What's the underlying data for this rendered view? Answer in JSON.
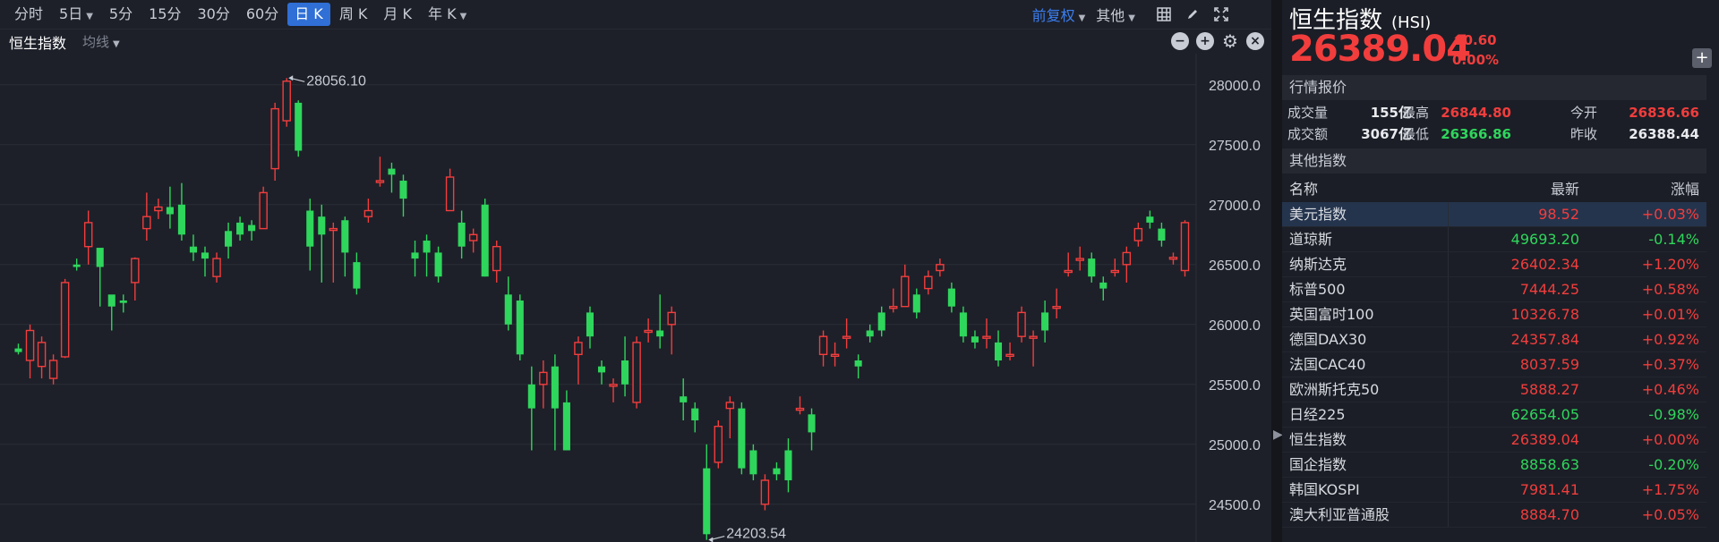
{
  "toolbar": {
    "tabs": [
      {
        "label": "分时",
        "caret": false
      },
      {
        "label": "5日",
        "caret": true
      },
      {
        "label": "5分",
        "caret": false
      },
      {
        "label": "15分",
        "caret": false
      },
      {
        "label": "30分",
        "caret": false
      },
      {
        "label": "60分",
        "caret": false
      },
      {
        "label": "日 K",
        "caret": false,
        "active": true
      },
      {
        "label": "周 K",
        "caret": false
      },
      {
        "label": "月 K",
        "caret": false
      },
      {
        "label": "年 K",
        "caret": true
      }
    ],
    "adjust_label": "前复权",
    "other_label": "其他",
    "icons": [
      "grid-icon",
      "pen-icon",
      "fullscreen-icon"
    ]
  },
  "subbar": {
    "title": "恒生指数",
    "ma_label": "均线",
    "controls": [
      "minus-icon",
      "plus-icon",
      "gear-icon",
      "close-icon"
    ]
  },
  "quote": {
    "name": "恒生指数",
    "code": "(HSI)",
    "price": "26389.04",
    "change": "0.60",
    "change_pct": "0.00%",
    "direction": "up"
  },
  "market": {
    "section_title": "行情报价",
    "rows": [
      {
        "l1": "成交量",
        "v1": "155亿",
        "l2": "最高",
        "v2": "26844.80",
        "l3": "今开",
        "v3": "26836.66",
        "c2": "red",
        "c3": "red"
      },
      {
        "l1": "成交额",
        "v1": "3067亿",
        "l2": "最低",
        "v2": "26366.86",
        "l3": "昨收",
        "v3": "26388.44",
        "c2": "green",
        "c3": "white"
      }
    ]
  },
  "other_indices": {
    "section_title": "其他指数",
    "columns": [
      "名称",
      "最新",
      "涨幅"
    ],
    "rows": [
      {
        "name": "美元指数",
        "last": "98.52",
        "chg": "+0.03%",
        "color": "red",
        "selected": true
      },
      {
        "name": "道琼斯",
        "last": "49693.20",
        "chg": "-0.14%",
        "color": "green"
      },
      {
        "name": "纳斯达克",
        "last": "26402.34",
        "chg": "+1.20%",
        "color": "red"
      },
      {
        "name": "标普500",
        "last": "7444.25",
        "chg": "+0.58%",
        "color": "red"
      },
      {
        "name": "英国富时100",
        "last": "10326.78",
        "chg": "+0.01%",
        "color": "red"
      },
      {
        "name": "德国DAX30",
        "last": "24357.84",
        "chg": "+0.92%",
        "color": "red"
      },
      {
        "name": "法国CAC40",
        "last": "8037.59",
        "chg": "+0.37%",
        "color": "red"
      },
      {
        "name": "欧洲斯托克50",
        "last": "5888.27",
        "chg": "+0.46%",
        "color": "red"
      },
      {
        "name": "日经225",
        "last": "62654.05",
        "chg": "-0.98%",
        "color": "green"
      },
      {
        "name": "恒生指数",
        "last": "26389.04",
        "chg": "+0.00%",
        "color": "red"
      },
      {
        "name": "国企指数",
        "last": "8858.63",
        "chg": "-0.20%",
        "color": "green"
      },
      {
        "name": "韩国KOSPI",
        "last": "7981.41",
        "chg": "+1.75%",
        "color": "red"
      },
      {
        "name": "澳大利亚普通股",
        "last": "8884.70",
        "chg": "+0.05%",
        "color": "red"
      }
    ]
  },
  "colors": {
    "up": "#f23d3d",
    "down": "#2fd65c",
    "accent": "#2f6fd6",
    "grid": "#2a2d36"
  },
  "chart_data": {
    "type": "candlestick",
    "ylim": [
      24200,
      28200
    ],
    "ticks": [
      "28000.0",
      "27500.0",
      "27000.0",
      "26500.0",
      "26000.0",
      "25500.0",
      "25000.0",
      "24500.0"
    ],
    "annotations": [
      {
        "label": "28056.10",
        "value": 28056.1
      },
      {
        "label": "24203.54",
        "value": 24203.54
      }
    ],
    "candles": [
      [
        25800,
        25770,
        25840,
        25750
      ],
      [
        25700,
        25950,
        26000,
        25550
      ],
      [
        25650,
        25850,
        25900,
        25550
      ],
      [
        25550,
        25700,
        25750,
        25500
      ],
      [
        25730,
        26350,
        26380,
        25720
      ],
      [
        26500,
        26480,
        26550,
        26450
      ],
      [
        26650,
        26850,
        26950,
        26500
      ],
      [
        26640,
        26480,
        26500,
        26150
      ],
      [
        26250,
        26150,
        26200,
        25950
      ],
      [
        26200,
        26180,
        26250,
        26100
      ],
      [
        26350,
        26550,
        26560,
        26200
      ],
      [
        26800,
        26900,
        27100,
        26700
      ],
      [
        26950,
        26980,
        27050,
        26880
      ],
      [
        26980,
        26920,
        27150,
        26800
      ],
      [
        27000,
        26750,
        27180,
        26700
      ],
      [
        26650,
        26600,
        26750,
        26530
      ],
      [
        26600,
        26550,
        26650,
        26400
      ],
      [
        26400,
        26550,
        26600,
        26350
      ],
      [
        26780,
        26650,
        26850,
        26550
      ],
      [
        26850,
        26750,
        26900,
        26700
      ],
      [
        26830,
        26780,
        26870,
        26700
      ],
      [
        26800,
        27100,
        27150,
        26800
      ],
      [
        27300,
        27800,
        27850,
        27200
      ],
      [
        27700,
        28030,
        28056,
        27650
      ],
      [
        27850,
        27450,
        27870,
        27400
      ],
      [
        26950,
        26650,
        27050,
        26450
      ],
      [
        26900,
        26750,
        27000,
        26350
      ],
      [
        26800,
        26800,
        26850,
        26350
      ],
      [
        26870,
        26600,
        26900,
        26400
      ],
      [
        26520,
        26300,
        26600,
        26250
      ],
      [
        26900,
        26950,
        27050,
        26850
      ],
      [
        27200,
        27200,
        27400,
        27150
      ],
      [
        27300,
        27250,
        27350,
        27100
      ],
      [
        27200,
        27050,
        27250,
        26900
      ],
      [
        26600,
        26550,
        26700,
        26400
      ],
      [
        26700,
        26600,
        26750,
        26400
      ],
      [
        26600,
        26400,
        26650,
        26350
      ],
      [
        26950,
        27230,
        27300,
        26950
      ],
      [
        26850,
        26650,
        26950,
        26550
      ],
      [
        26700,
        26750,
        26800,
        26600
      ],
      [
        27000,
        26400,
        27050,
        26400
      ],
      [
        26450,
        26650,
        26700,
        26350
      ],
      [
        26250,
        26000,
        26400,
        25950
      ],
      [
        26200,
        25750,
        26250,
        25700
      ],
      [
        25500,
        25300,
        25650,
        24950
      ],
      [
        25500,
        25600,
        25700,
        25300
      ],
      [
        25650,
        25300,
        25750,
        24950
      ],
      [
        25350,
        24950,
        25450,
        24950
      ],
      [
        25750,
        25850,
        25900,
        25500
      ],
      [
        26100,
        25900,
        26150,
        25800
      ],
      [
        25650,
        25600,
        25700,
        25500
      ],
      [
        25500,
        25500,
        25550,
        25350
      ],
      [
        25700,
        25500,
        25900,
        25400
      ],
      [
        25350,
        25850,
        25900,
        25300
      ],
      [
        25950,
        25950,
        26050,
        25850
      ],
      [
        25950,
        25900,
        26250,
        25800
      ],
      [
        26000,
        26100,
        26150,
        25750
      ],
      [
        25400,
        25350,
        25550,
        25200
      ],
      [
        25300,
        25200,
        25350,
        25100
      ],
      [
        24800,
        24250,
        25000,
        24203
      ],
      [
        24850,
        25150,
        25200,
        24800
      ],
      [
        25300,
        25350,
        25400,
        25050
      ],
      [
        25300,
        24800,
        25350,
        24750
      ],
      [
        24950,
        24750,
        25000,
        24700
      ],
      [
        24500,
        24700,
        24750,
        24450
      ],
      [
        24800,
        24750,
        24850,
        24700
      ],
      [
        24950,
        24700,
        25050,
        24600
      ],
      [
        25300,
        25300,
        25400,
        25250
      ],
      [
        25250,
        25100,
        25300,
        24950
      ],
      [
        25750,
        25900,
        25950,
        25650
      ],
      [
        25750,
        25750,
        25850,
        25650
      ],
      [
        25900,
        25900,
        26050,
        25800
      ],
      [
        25700,
        25650,
        25750,
        25550
      ],
      [
        25950,
        25900,
        26000,
        25850
      ],
      [
        26100,
        25950,
        26150,
        25900
      ],
      [
        26150,
        26150,
        26300,
        26100
      ],
      [
        26150,
        26400,
        26500,
        26150
      ],
      [
        26250,
        26100,
        26300,
        26050
      ],
      [
        26300,
        26400,
        26450,
        26250
      ],
      [
        26450,
        26500,
        26550,
        26400
      ],
      [
        26300,
        26150,
        26350,
        26100
      ],
      [
        26100,
        25900,
        26150,
        25850
      ],
      [
        25900,
        25850,
        25950,
        25800
      ],
      [
        25900,
        25900,
        26050,
        25800
      ],
      [
        25850,
        25700,
        25950,
        25650
      ],
      [
        25750,
        25750,
        25850,
        25700
      ],
      [
        25900,
        26100,
        26150,
        25850
      ],
      [
        25900,
        25900,
        25950,
        25650
      ],
      [
        26100,
        25950,
        26200,
        25850
      ],
      [
        26150,
        26150,
        26300,
        26050
      ],
      [
        26450,
        26450,
        26600,
        26400
      ],
      [
        26550,
        26550,
        26650,
        26450
      ],
      [
        26550,
        26400,
        26600,
        26350
      ],
      [
        26350,
        26300,
        26400,
        26200
      ],
      [
        26450,
        26450,
        26550,
        26400
      ],
      [
        26500,
        26600,
        26650,
        26350
      ],
      [
        26700,
        26800,
        26850,
        26650
      ],
      [
        26900,
        26850,
        26950,
        26800
      ],
      [
        26800,
        26700,
        26850,
        26650
      ],
      [
        26560,
        26560,
        26600,
        26500
      ],
      [
        26450,
        26850,
        26870,
        26400
      ]
    ]
  }
}
